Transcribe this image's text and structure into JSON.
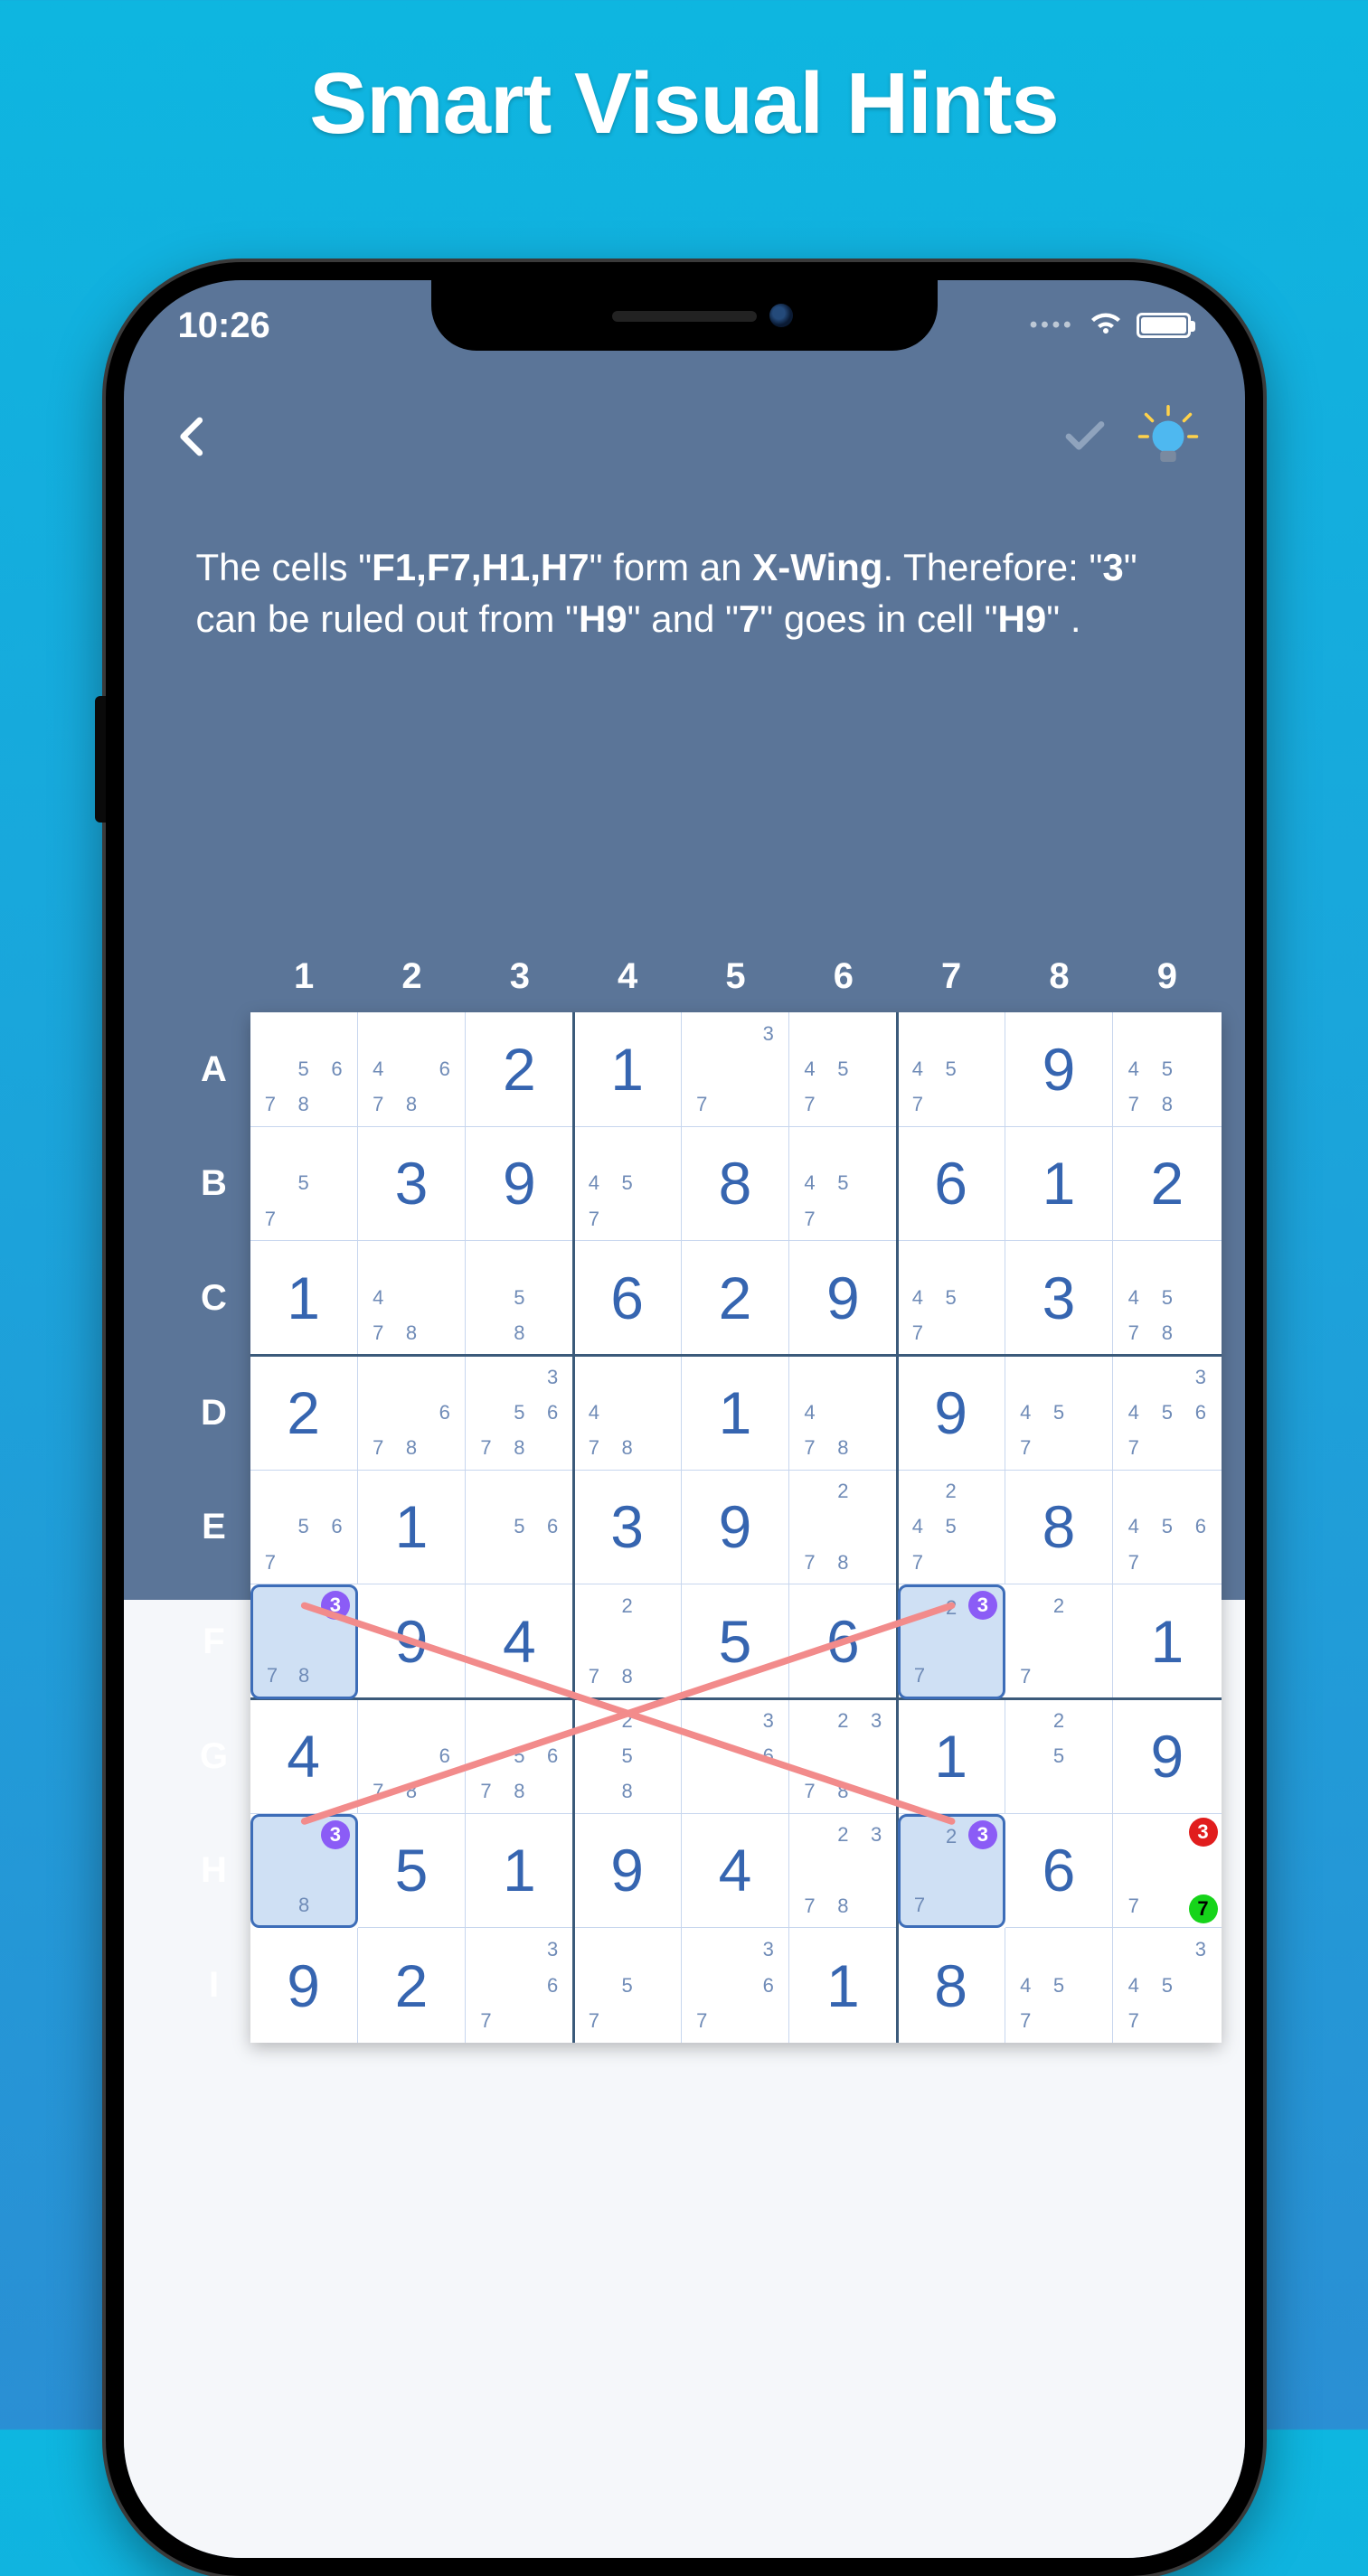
{
  "marketing": {
    "headline": "Smart Visual Hints"
  },
  "statusbar": {
    "time": "10:26"
  },
  "toolbar": {
    "back": "back",
    "check": "check",
    "hint": "hint"
  },
  "hint": {
    "pre": "The cells \"",
    "cells": "F1,F7,H1,H7",
    "mid1": "\" form an ",
    "pattern": "X-Wing",
    "mid2": ". Therefore: \"",
    "ruleout_digit": "3",
    "mid3": "\" can be ruled out from \"",
    "ruleout_cell": "H9",
    "mid4": "\" and \"",
    "place_digit": "7",
    "mid5": "\" goes in cell \"",
    "place_cell": "H9",
    "tail": "\" ."
  },
  "board": {
    "cols": [
      "1",
      "2",
      "3",
      "4",
      "5",
      "6",
      "7",
      "8",
      "9"
    ],
    "rows": [
      "A",
      "B",
      "C",
      "D",
      "E",
      "F",
      "G",
      "H",
      "I"
    ],
    "cells": {
      "A1": {
        "cand": [
          5,
          6,
          7,
          8
        ]
      },
      "A2": {
        "cand": [
          4,
          6,
          7,
          8
        ]
      },
      "A3": {
        "v": "2"
      },
      "A4": {
        "v": "1"
      },
      "A5": {
        "cand": [
          3,
          7
        ]
      },
      "A6": {
        "cand": [
          4,
          5,
          7
        ]
      },
      "A7": {
        "cand": [
          4,
          5,
          7
        ]
      },
      "A8": {
        "v": "9"
      },
      "A9": {
        "cand": [
          4,
          5,
          7,
          8
        ]
      },
      "B1": {
        "cand": [
          5,
          7
        ]
      },
      "B2": {
        "v": "3"
      },
      "B3": {
        "v": "9"
      },
      "B4": {
        "cand": [
          4,
          5,
          7
        ]
      },
      "B5": {
        "v": "8"
      },
      "B6": {
        "cand": [
          4,
          5,
          7
        ]
      },
      "B7": {
        "v": "6"
      },
      "B8": {
        "v": "1"
      },
      "B9": {
        "v": "2"
      },
      "C1": {
        "v": "1"
      },
      "C2": {
        "cand": [
          4,
          7,
          8
        ]
      },
      "C3": {
        "cand": [
          5,
          8
        ]
      },
      "C4": {
        "v": "6"
      },
      "C5": {
        "v": "2"
      },
      "C6": {
        "v": "9"
      },
      "C7": {
        "cand": [
          4,
          5,
          7
        ]
      },
      "C8": {
        "v": "3"
      },
      "C9": {
        "cand": [
          4,
          5,
          7,
          8
        ]
      },
      "D1": {
        "v": "2"
      },
      "D2": {
        "cand": [
          6,
          7,
          8
        ]
      },
      "D3": {
        "cand": [
          3,
          5,
          6,
          7,
          8
        ]
      },
      "D4": {
        "cand": [
          4,
          7,
          8
        ]
      },
      "D5": {
        "v": "1"
      },
      "D6": {
        "cand": [
          4,
          7,
          8
        ]
      },
      "D7": {
        "v": "9"
      },
      "D8": {
        "cand": [
          4,
          5,
          7
        ]
      },
      "D9": {
        "cand": [
          3,
          4,
          5,
          6,
          7
        ]
      },
      "E1": {
        "cand": [
          5,
          6,
          7
        ]
      },
      "E2": {
        "v": "1"
      },
      "E3": {
        "cand": [
          5,
          6
        ]
      },
      "E4": {
        "v": "3"
      },
      "E5": {
        "v": "9"
      },
      "E6": {
        "cand": [
          2,
          7,
          8
        ]
      },
      "E7": {
        "cand": [
          2,
          4,
          5,
          7
        ]
      },
      "E8": {
        "v": "8"
      },
      "E9": {
        "cand": [
          4,
          5,
          6,
          7
        ]
      },
      "F1": {
        "cand": [
          3,
          7,
          8
        ],
        "hl": true,
        "dot": {
          "t": "purple",
          "v": "3"
        }
      },
      "F2": {
        "v": "9"
      },
      "F3": {
        "v": "4"
      },
      "F4": {
        "cand": [
          2,
          7,
          8
        ]
      },
      "F5": {
        "v": "5"
      },
      "F6": {
        "v": "6"
      },
      "F7": {
        "cand": [
          2,
          3,
          7
        ],
        "hl": true,
        "dot": {
          "t": "purple",
          "v": "3"
        }
      },
      "F8": {
        "cand": [
          2,
          7
        ]
      },
      "F9": {
        "v": "1"
      },
      "G1": {
        "v": "4"
      },
      "G2": {
        "cand": [
          6,
          7,
          8
        ]
      },
      "G3": {
        "cand": [
          5,
          6,
          7,
          8
        ]
      },
      "G4": {
        "cand": [
          2,
          5,
          8
        ]
      },
      "G5": {
        "cand": [
          3,
          6
        ]
      },
      "G6": {
        "cand": [
          2,
          3,
          7,
          8
        ]
      },
      "G7": {
        "v": "1"
      },
      "G8": {
        "cand": [
          2,
          5
        ]
      },
      "G9": {
        "v": "9"
      },
      "H1": {
        "cand": [
          3,
          8
        ],
        "hl": true,
        "dot": {
          "t": "purple",
          "v": "3"
        }
      },
      "H2": {
        "v": "5"
      },
      "H3": {
        "v": "1"
      },
      "H4": {
        "v": "9"
      },
      "H5": {
        "v": "4"
      },
      "H6": {
        "cand": [
          2,
          3,
          7,
          8
        ]
      },
      "H7": {
        "cand": [
          2,
          3,
          7
        ],
        "hl": true,
        "dot": {
          "t": "purple",
          "v": "3"
        }
      },
      "H8": {
        "v": "6"
      },
      "H9": {
        "cand": [
          3,
          7
        ],
        "dots": [
          {
            "t": "red",
            "v": "3"
          },
          {
            "t": "green",
            "v": "7"
          }
        ]
      },
      "I1": {
        "v": "9"
      },
      "I2": {
        "v": "2"
      },
      "I3": {
        "cand": [
          3,
          6,
          7
        ]
      },
      "I4": {
        "cand": [
          5,
          7
        ]
      },
      "I5": {
        "cand": [
          3,
          6,
          7
        ]
      },
      "I6": {
        "v": "1"
      },
      "I7": {
        "v": "8"
      },
      "I8": {
        "cand": [
          4,
          5,
          7
        ]
      },
      "I9": {
        "cand": [
          3,
          4,
          5,
          7
        ]
      }
    },
    "xwing": [
      "F1",
      "F7",
      "H1",
      "H7"
    ]
  }
}
